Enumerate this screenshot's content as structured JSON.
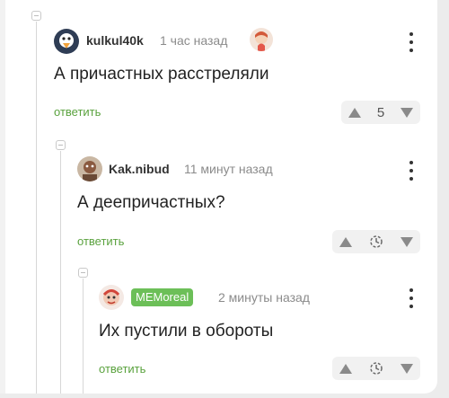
{
  "comments": [
    {
      "author": "kulkul40k",
      "time": "1 час назад",
      "text": "А причастных расстреляли",
      "reply_label": "ответить",
      "score": "5"
    },
    {
      "author": "Kak.nibud",
      "time": "11 минут назад",
      "text": "А деепричастных?",
      "reply_label": "ответить"
    },
    {
      "author": "MEMoreal",
      "time": "2 минуты назад",
      "text": "Их пустили в обороты",
      "reply_label": "ответить"
    }
  ],
  "colors": {
    "reply_green": "#5aa23e",
    "badge_green": "#6cbf58",
    "page_background": "#ececec"
  },
  "icons": [
    "collapse-icon",
    "avatar",
    "kebab-menu-icon",
    "upvote-icon",
    "downvote-icon",
    "clock-icon"
  ]
}
